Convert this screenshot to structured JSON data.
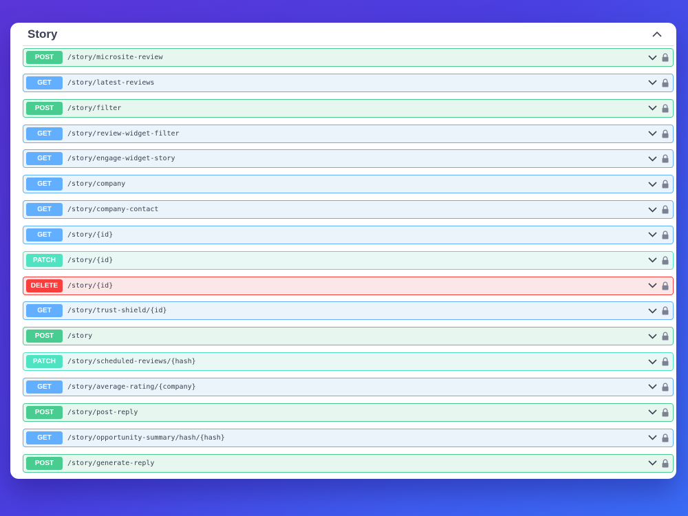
{
  "section": {
    "title": "Story",
    "collapse_icon": "chevron-up-icon"
  },
  "colors": {
    "get": "#61affe",
    "post": "#49cc90",
    "patch": "#50e3c2",
    "delete": "#f93e3e",
    "text": "#3b4151",
    "lock": "#7d8293"
  },
  "operations": [
    {
      "method": "POST",
      "path": "/story/microsite-review"
    },
    {
      "method": "GET",
      "path": "/story/latest-reviews"
    },
    {
      "method": "POST",
      "path": "/story/filter"
    },
    {
      "method": "GET",
      "path": "/story/review-widget-filter"
    },
    {
      "method": "GET",
      "path": "/story/engage-widget-story"
    },
    {
      "method": "GET",
      "path": "/story/company"
    },
    {
      "method": "GET",
      "path": "/story/company-contact"
    },
    {
      "method": "GET",
      "path": "/story/{id}"
    },
    {
      "method": "PATCH",
      "path": "/story/{id}"
    },
    {
      "method": "DELETE",
      "path": "/story/{id}"
    },
    {
      "method": "GET",
      "path": "/story/trust-shield/{id}"
    },
    {
      "method": "POST",
      "path": "/story"
    },
    {
      "method": "PATCH",
      "path": "/story/scheduled-reviews/{hash}"
    },
    {
      "method": "GET",
      "path": "/story/average-rating/{company}"
    },
    {
      "method": "POST",
      "path": "/story/post-reply"
    },
    {
      "method": "GET",
      "path": "/story/opportunity-summary/hash/{hash}"
    },
    {
      "method": "POST",
      "path": "/story/generate-reply"
    }
  ]
}
